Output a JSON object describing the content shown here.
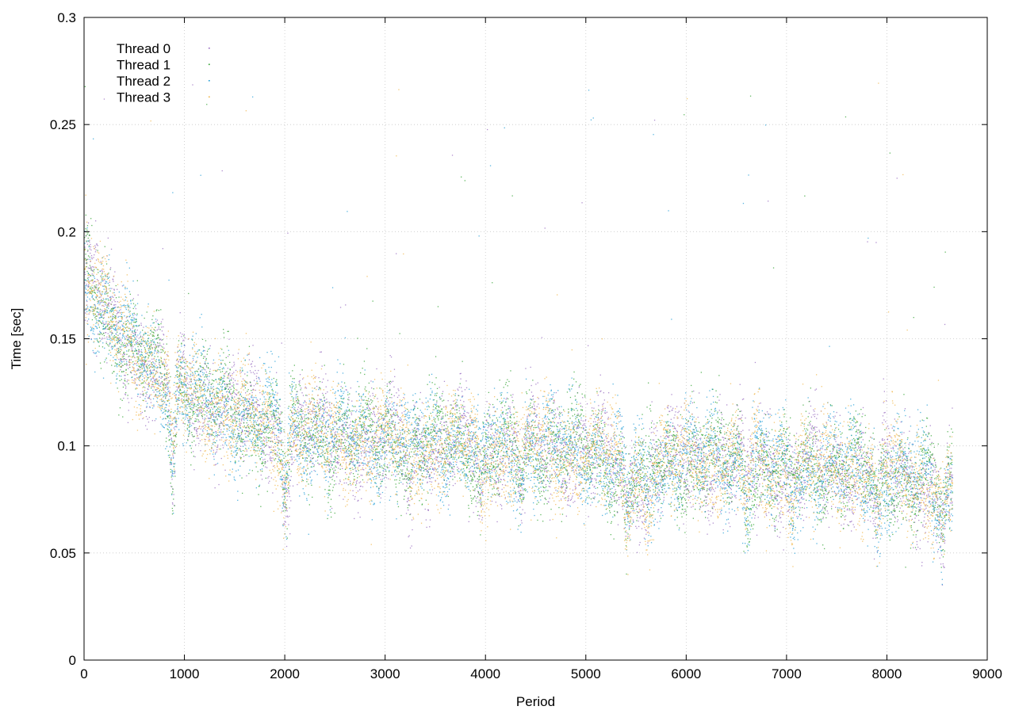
{
  "chart_data": {
    "type": "scatter",
    "title": "",
    "xlabel": "Period",
    "ylabel": "Time [sec]",
    "xlim": [
      0,
      9000
    ],
    "ylim": [
      0,
      0.3
    ],
    "x_ticks": [
      "0",
      "1000",
      "2000",
      "3000",
      "4000",
      "5000",
      "6000",
      "7000",
      "8000",
      "9000"
    ],
    "y_ticks": [
      "0",
      "0.05",
      "0.1",
      "0.15",
      "0.2",
      "0.25",
      "0.3"
    ],
    "grid": true,
    "legend_position": "top-left",
    "x_range": [
      0,
      8650
    ],
    "series": [
      {
        "name": "Thread 0",
        "color": "#9467bd",
        "trend": [
          [
            0,
            0.18
          ],
          [
            100,
            0.172
          ],
          [
            300,
            0.155
          ],
          [
            600,
            0.14
          ],
          [
            900,
            0.128
          ],
          [
            1200,
            0.122
          ],
          [
            1500,
            0.115
          ],
          [
            2000,
            0.107
          ],
          [
            2500,
            0.104
          ],
          [
            3000,
            0.103
          ],
          [
            3500,
            0.101
          ],
          [
            4000,
            0.1
          ],
          [
            4500,
            0.099
          ],
          [
            5000,
            0.097
          ],
          [
            5500,
            0.088
          ],
          [
            6000,
            0.094
          ],
          [
            6500,
            0.092
          ],
          [
            7000,
            0.09
          ],
          [
            7500,
            0.09
          ],
          [
            8000,
            0.088
          ],
          [
            8650,
            0.078
          ]
        ]
      },
      {
        "name": "Thread 1",
        "color": "#2ca02c",
        "trend": [
          [
            0,
            0.18
          ],
          [
            100,
            0.172
          ],
          [
            300,
            0.155
          ],
          [
            600,
            0.14
          ],
          [
            900,
            0.128
          ],
          [
            1200,
            0.122
          ],
          [
            1500,
            0.115
          ],
          [
            2000,
            0.107
          ],
          [
            2500,
            0.104
          ],
          [
            3000,
            0.103
          ],
          [
            3500,
            0.101
          ],
          [
            4000,
            0.1
          ],
          [
            4500,
            0.099
          ],
          [
            5000,
            0.097
          ],
          [
            5500,
            0.088
          ],
          [
            6000,
            0.094
          ],
          [
            6500,
            0.092
          ],
          [
            7000,
            0.09
          ],
          [
            7500,
            0.09
          ],
          [
            8000,
            0.088
          ],
          [
            8650,
            0.078
          ]
        ]
      },
      {
        "name": "Thread 2",
        "color": "#1f9bd6",
        "trend": [
          [
            0,
            0.18
          ],
          [
            100,
            0.172
          ],
          [
            300,
            0.155
          ],
          [
            600,
            0.14
          ],
          [
            900,
            0.128
          ],
          [
            1200,
            0.122
          ],
          [
            1500,
            0.115
          ],
          [
            2000,
            0.107
          ],
          [
            2500,
            0.104
          ],
          [
            3000,
            0.103
          ],
          [
            3500,
            0.101
          ],
          [
            4000,
            0.1
          ],
          [
            4500,
            0.099
          ],
          [
            5000,
            0.097
          ],
          [
            5500,
            0.088
          ],
          [
            6000,
            0.094
          ],
          [
            6500,
            0.092
          ],
          [
            7000,
            0.09
          ],
          [
            7500,
            0.09
          ],
          [
            8000,
            0.088
          ],
          [
            8650,
            0.078
          ]
        ]
      },
      {
        "name": "Thread 3",
        "color": "#f0b445",
        "trend": [
          [
            0,
            0.18
          ],
          [
            100,
            0.172
          ],
          [
            300,
            0.155
          ],
          [
            600,
            0.14
          ],
          [
            900,
            0.128
          ],
          [
            1200,
            0.122
          ],
          [
            1500,
            0.115
          ],
          [
            2000,
            0.107
          ],
          [
            2500,
            0.104
          ],
          [
            3000,
            0.103
          ],
          [
            3500,
            0.101
          ],
          [
            4000,
            0.1
          ],
          [
            4500,
            0.099
          ],
          [
            5000,
            0.097
          ],
          [
            5500,
            0.088
          ],
          [
            6000,
            0.094
          ],
          [
            6500,
            0.092
          ],
          [
            7000,
            0.09
          ],
          [
            7500,
            0.09
          ],
          [
            8000,
            0.088
          ],
          [
            8650,
            0.078
          ]
        ]
      }
    ]
  }
}
